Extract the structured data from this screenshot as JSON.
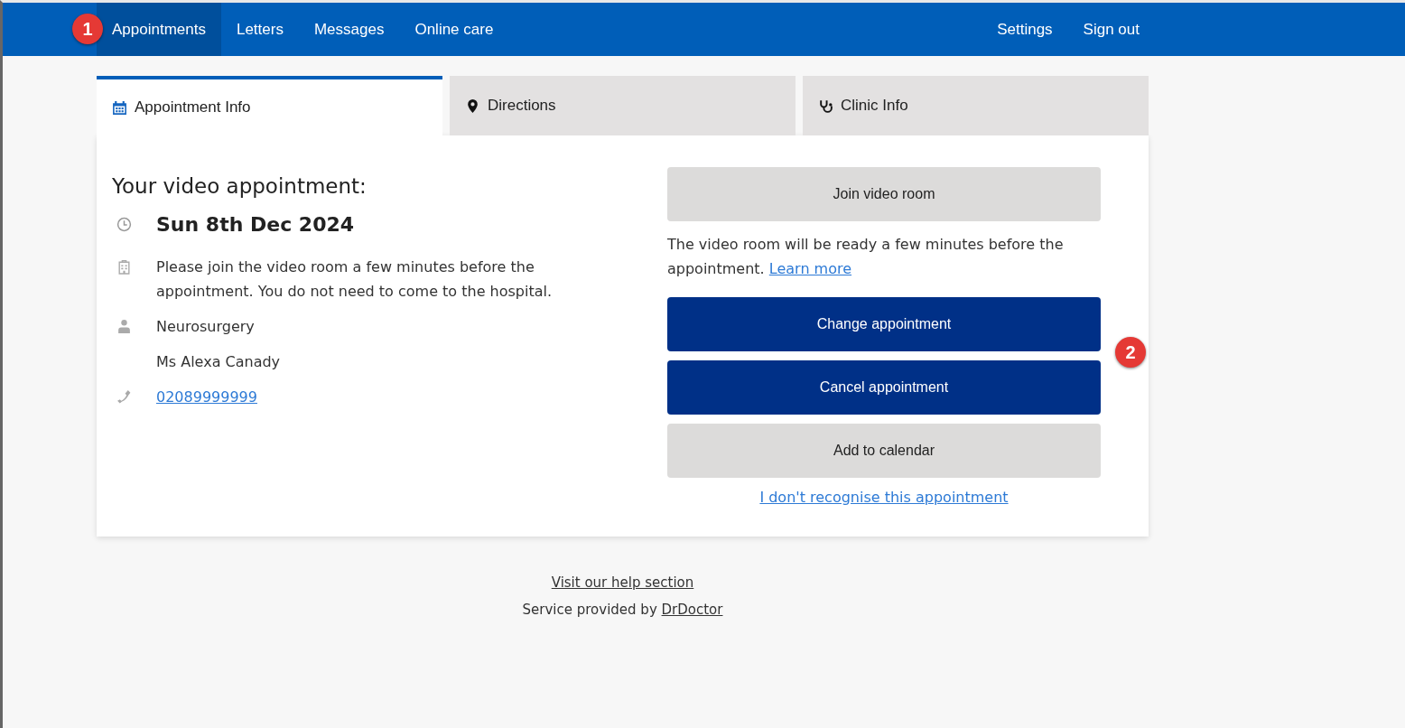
{
  "nav": {
    "items": [
      {
        "label": "Appointments",
        "selected": true
      },
      {
        "label": "Letters",
        "selected": false
      },
      {
        "label": "Messages",
        "selected": false
      },
      {
        "label": "Online care",
        "selected": false
      }
    ],
    "right_items": [
      "Settings",
      "Sign out"
    ]
  },
  "callouts": [
    "1",
    "2"
  ],
  "tabs": [
    {
      "label": "Appointment Info",
      "selected": true
    },
    {
      "label": "Directions",
      "selected": false
    },
    {
      "label": "Clinic Info",
      "selected": false
    }
  ],
  "appointment": {
    "heading": "Your video appointment:",
    "details": [
      {
        "kind": "date",
        "text": "Sun 8th Dec 2024"
      },
      {
        "kind": "location",
        "text": "Please join the video room a few minutes before the appointment. You do not need to come to the hospital."
      },
      {
        "kind": "department",
        "text": "Neurosurgery"
      },
      {
        "kind": "clinician",
        "text": "Ms Alexa Canady"
      },
      {
        "kind": "phone",
        "text": "02089999999"
      }
    ]
  },
  "actions": [
    {
      "kind": "secondary",
      "label": "Join video room"
    },
    {
      "kind": "note",
      "label": "The video room will be ready a few minutes before the appointment.",
      "link": "Learn more"
    },
    {
      "kind": "primary",
      "label": "Change appointment"
    },
    {
      "kind": "primary",
      "label": "Cancel appointment"
    },
    {
      "kind": "secondary",
      "label": "Add to calendar"
    },
    {
      "kind": "link",
      "label": "I don't recognise this appointment"
    }
  ],
  "footer": {
    "help_link": "Visit our help section",
    "provided_by": "Service provided by",
    "provider_link": "DrDoctor"
  }
}
